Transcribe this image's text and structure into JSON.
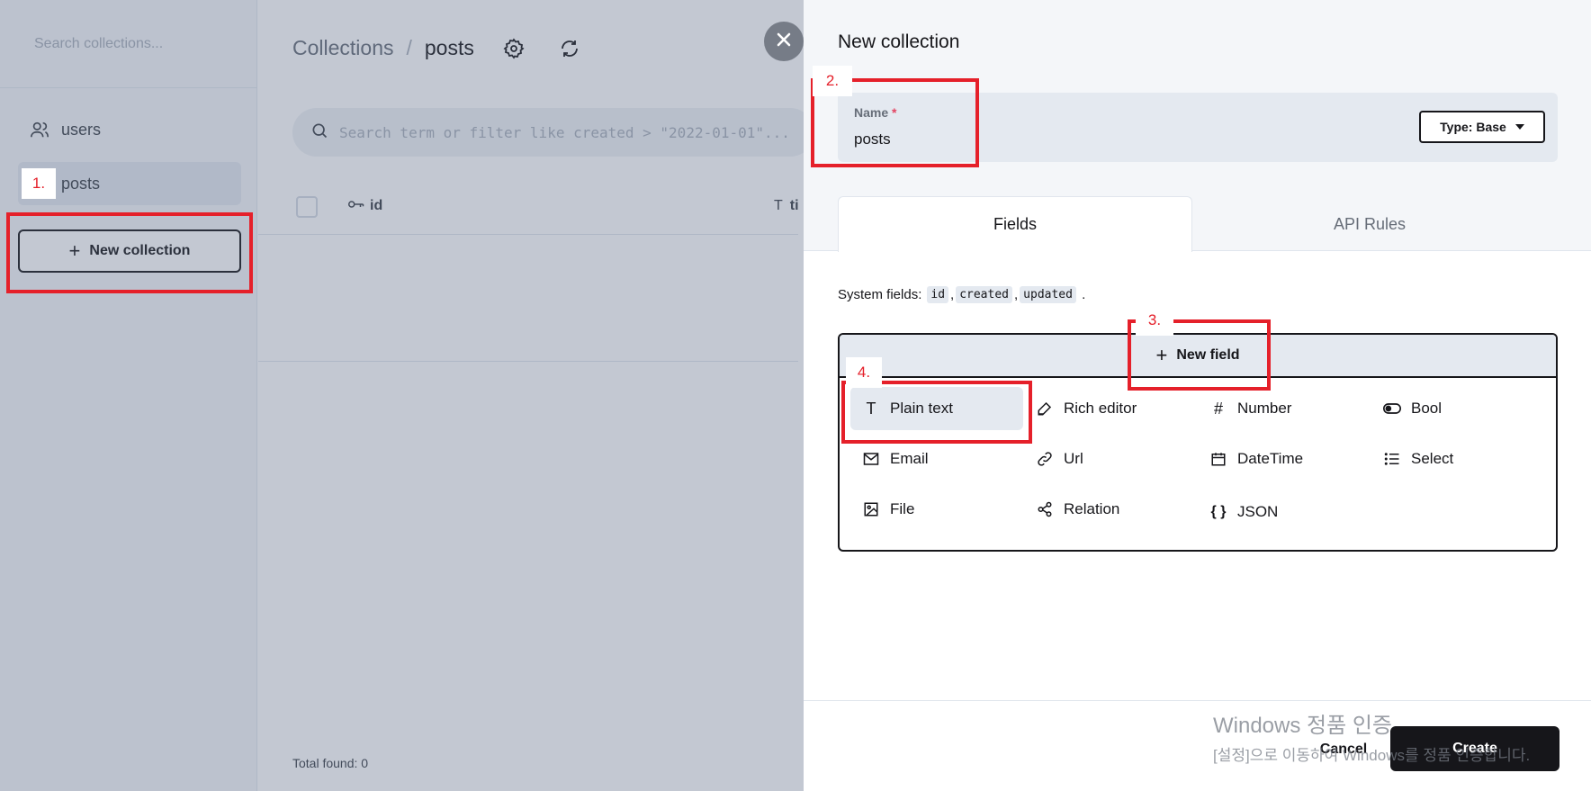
{
  "sidebar": {
    "search_placeholder": "Search collections...",
    "items": [
      {
        "label": "users",
        "icon": "users-icon"
      },
      {
        "label": "posts",
        "icon": "collection-icon"
      }
    ],
    "new_collection_label": "New collection"
  },
  "main": {
    "breadcrumb_root": "Collections",
    "breadcrumb_sep": "/",
    "breadcrumb_current": "posts",
    "search_placeholder": "Search term or filter like created > \"2022-01-01\"...",
    "columns": [
      {
        "label": "id",
        "icon": "key-icon"
      },
      {
        "label": "ti",
        "icon": "text-icon"
      }
    ],
    "total_found": "Total found:  0"
  },
  "panel": {
    "title": "New collection",
    "name_label": "Name",
    "required_marker": "*",
    "name_value": "posts",
    "type_button": "Type: Base",
    "tabs": [
      "Fields",
      "API Rules"
    ],
    "system_fields_label": "System fields:",
    "system_fields": [
      "id",
      "created",
      "updated"
    ],
    "new_field_label": "New field",
    "field_types": [
      {
        "label": "Plain text",
        "icon": "T"
      },
      {
        "label": "Rich editor",
        "icon": "pen-icon"
      },
      {
        "label": "Number",
        "icon": "#"
      },
      {
        "label": "Bool",
        "icon": "toggle-icon"
      },
      {
        "label": "Email",
        "icon": "mail-icon"
      },
      {
        "label": "Url",
        "icon": "link-icon"
      },
      {
        "label": "DateTime",
        "icon": "calendar-icon"
      },
      {
        "label": "Select",
        "icon": "list-icon"
      },
      {
        "label": "File",
        "icon": "image-icon"
      },
      {
        "label": "Relation",
        "icon": "relation-icon"
      },
      {
        "label": "JSON",
        "icon": "{ }"
      }
    ],
    "cancel_label": "Cancel",
    "create_label": "Create"
  },
  "annotations": [
    "1.",
    "2.",
    "3.",
    "4."
  ],
  "watermark": {
    "line1": "Windows 정품 인증",
    "line2": "[설정]으로 이동하여 Windows를 정품 인증합니다."
  },
  "colors": {
    "annotation": "#e5202a",
    "overlay": "#52617d",
    "primary": "#16161a"
  }
}
